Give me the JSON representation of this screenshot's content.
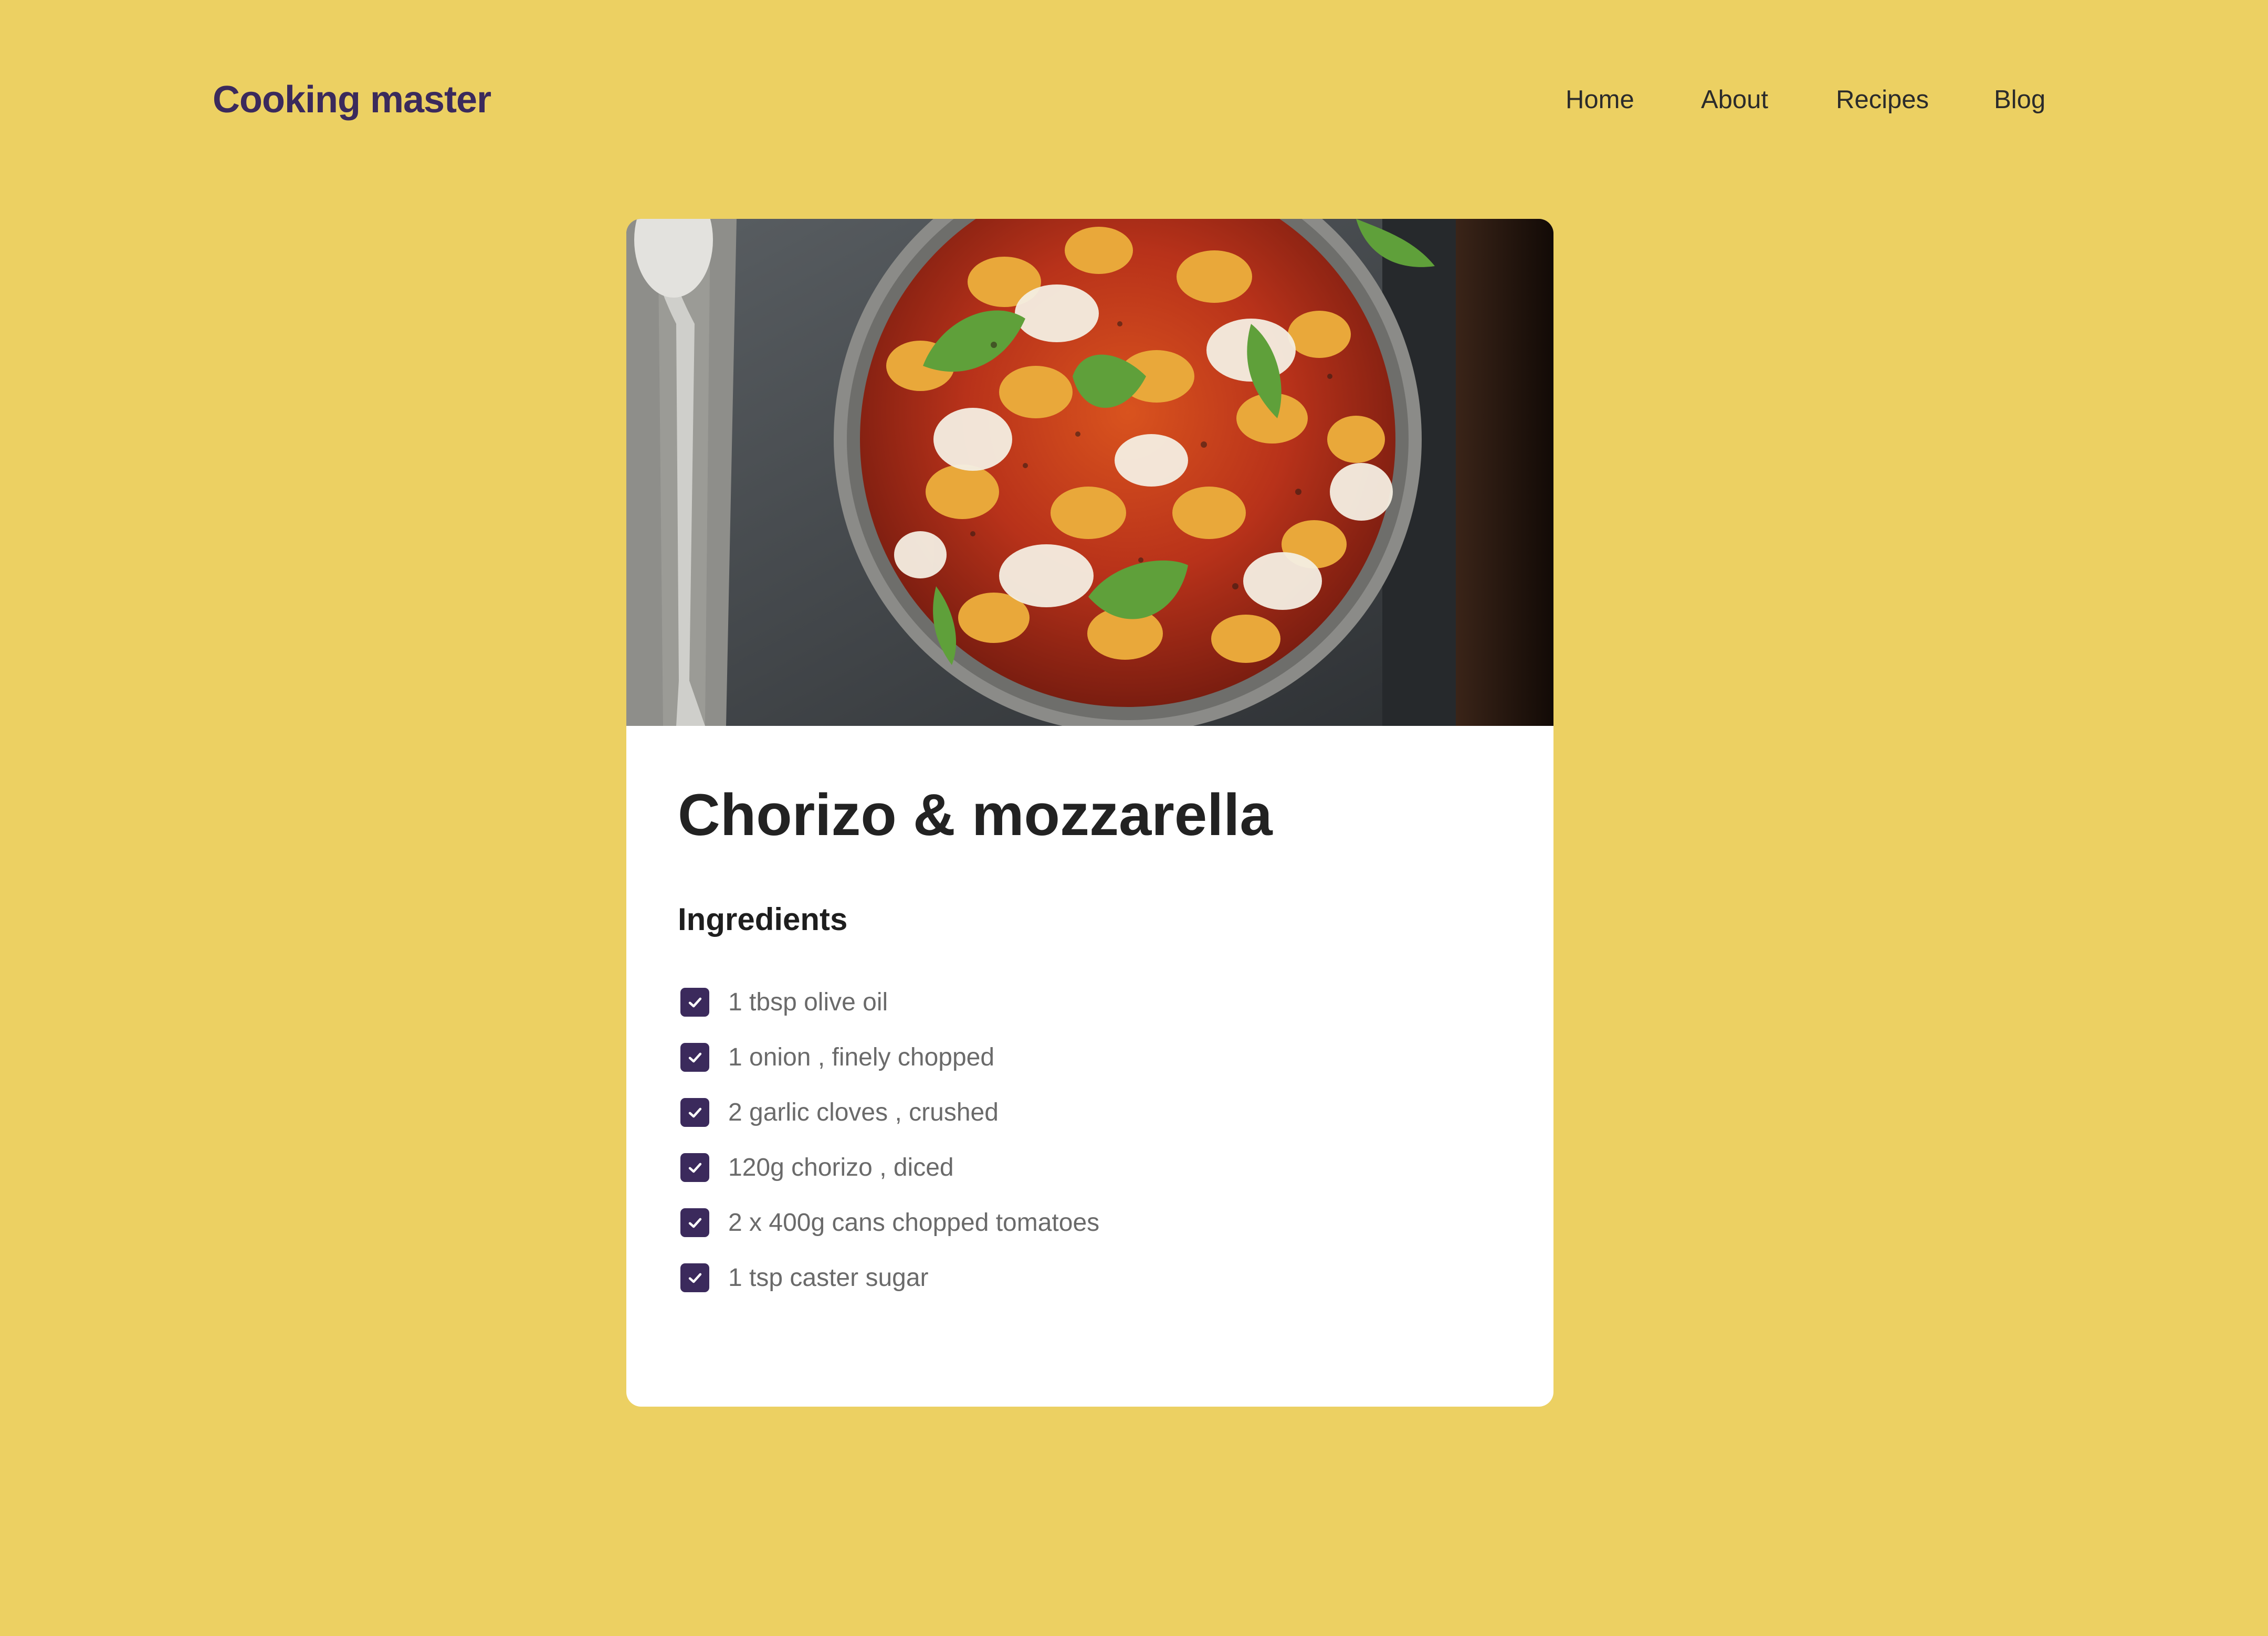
{
  "site": {
    "logo": "Cooking master"
  },
  "nav": {
    "items": [
      {
        "label": "Home"
      },
      {
        "label": "About"
      },
      {
        "label": "Recipes"
      },
      {
        "label": "Blog"
      }
    ]
  },
  "recipe": {
    "image_alt": "Gnocchi with chorizo, mozzarella and basil in a pan",
    "title": "Chorizo & mozzarella",
    "ingredients_heading": "Ingredients",
    "ingredients": [
      {
        "text": "1 tbsp olive oil",
        "checked": true
      },
      {
        "text": "1 onion , finely chopped",
        "checked": true
      },
      {
        "text": "2 garlic cloves , crushed",
        "checked": true
      },
      {
        "text": "120g chorizo , diced",
        "checked": true
      },
      {
        "text": "2 x 400g cans chopped tomatoes",
        "checked": true
      },
      {
        "text": "1 tsp caster sugar",
        "checked": true
      }
    ]
  },
  "colors": {
    "background": "#ECD062",
    "brand": "#3B2A5C",
    "card": "#FFFFFF"
  }
}
